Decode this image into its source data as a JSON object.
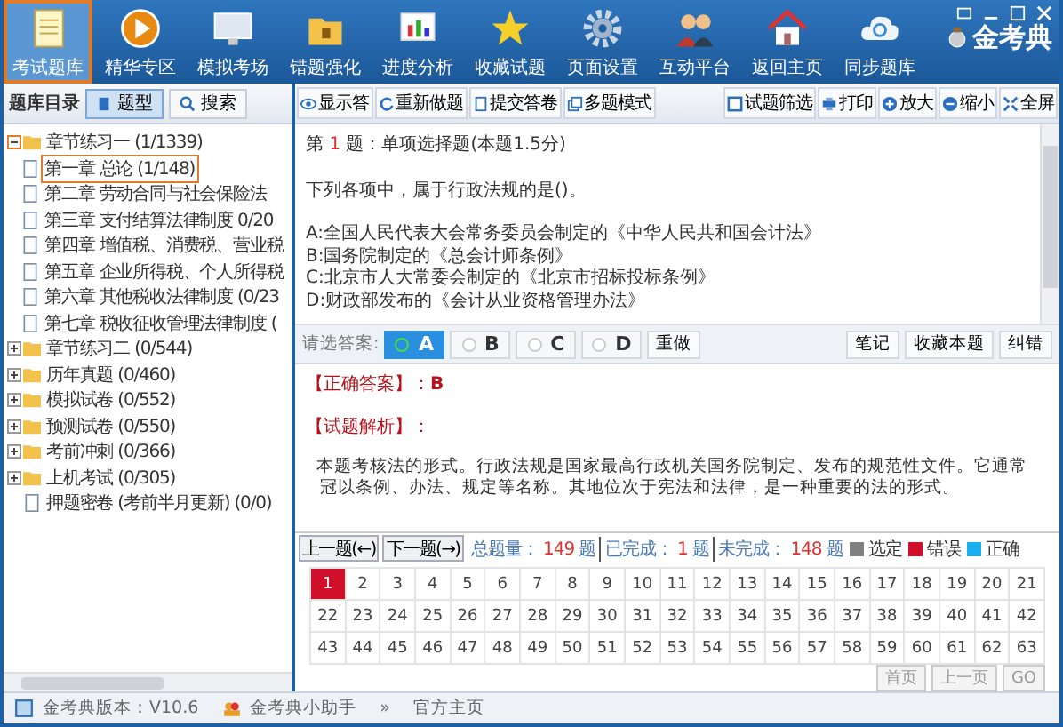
{
  "nav": [
    {
      "label": "考试题库",
      "selected": true
    },
    {
      "label": "精华专区",
      "selected": false
    },
    {
      "label": "模拟考场",
      "selected": false
    },
    {
      "label": "错题强化",
      "selected": false
    },
    {
      "label": "进度分析",
      "selected": false
    },
    {
      "label": "收藏试题",
      "selected": false
    },
    {
      "label": "页面设置",
      "selected": false
    },
    {
      "label": "互动平台",
      "selected": false
    },
    {
      "label": "返回主页",
      "selected": false
    },
    {
      "label": "同步题库",
      "selected": false
    }
  ],
  "logo": "金考典",
  "sidebar": {
    "title": "题库目录",
    "tabs": [
      {
        "label": "题型",
        "selected": true
      },
      {
        "label": "搜索",
        "selected": false
      }
    ],
    "tree": [
      {
        "label": "章节练习一 (1/1339)",
        "kind": "folder",
        "expanded": true,
        "selected": false,
        "children": [
          {
            "label": "第一章 总论 (1/148)",
            "kind": "file",
            "selected": true
          },
          {
            "label": "第二章 劳动合同与社会保险法",
            "kind": "file",
            "selected": false
          },
          {
            "label": "第三章 支付结算法律制度 0/20",
            "kind": "file",
            "selected": false
          },
          {
            "label": "第四章 增值税、消费税、营业税",
            "kind": "file",
            "selected": false
          },
          {
            "label": "第五章 企业所得税、个人所得税",
            "kind": "file",
            "selected": false
          },
          {
            "label": "第六章 其他税收法律制度 (0/23",
            "kind": "file",
            "selected": false
          },
          {
            "label": "第七章 税收征收管理法律制度 (",
            "kind": "file",
            "selected": false
          }
        ]
      },
      {
        "label": "章节练习二 (0/544)",
        "kind": "folder",
        "expanded": false,
        "selected": false
      },
      {
        "label": "历年真题 (0/460)",
        "kind": "folder",
        "expanded": false,
        "selected": false
      },
      {
        "label": "模拟试卷 (0/552)",
        "kind": "folder",
        "expanded": false,
        "selected": false
      },
      {
        "label": "预测试卷 (0/550)",
        "kind": "folder",
        "expanded": false,
        "selected": false
      },
      {
        "label": "考前冲刺 (0/366)",
        "kind": "folder",
        "expanded": false,
        "selected": false
      },
      {
        "label": "上机考试 (0/305)",
        "kind": "folder",
        "expanded": false,
        "selected": false
      },
      {
        "label": "押题密卷 (考前半月更新) (0/0)",
        "kind": "file",
        "selected": false
      }
    ]
  },
  "toolbar": {
    "left": [
      "显示答",
      "重新做题",
      "提交答卷",
      "多题模式"
    ],
    "right": [
      "试题筛选",
      "打印",
      "放大",
      "缩小",
      "全屏"
    ]
  },
  "question": {
    "prefix": "第",
    "number": "1",
    "suffix": "题：单项选择题(本题1.5分)",
    "stem": "下列各项中，属于行政法规的是()。",
    "options": [
      "A:全国人民代表大会常务委员会制定的《中华人民共和国会计法》",
      "B:国务院制定的《总会计师条例》",
      "C:北京市人大常委会制定的《北京市招标投标条例》",
      "D:财政部发布的《会计从业资格管理办法》"
    ]
  },
  "answer_bar": {
    "prompt": "请选答案:",
    "choices": [
      {
        "label": "A",
        "selected": true
      },
      {
        "label": "B",
        "selected": false
      },
      {
        "label": "C",
        "selected": false
      },
      {
        "label": "D",
        "selected": false
      }
    ],
    "redo": "重做",
    "actions": [
      "笔记",
      "收藏本题",
      "纠错"
    ]
  },
  "explanation": {
    "answer_label": "【正确答案】：",
    "answer": "B",
    "analysis_label": "【试题解析】：",
    "text": "本题考核法的形式。行政法规是国家最高行政机关国务院制定、发布的规范性文件。它通常冠以条例、办法、规定等名称。其地位次于宪法和法律，是一种重要的法的形式。"
  },
  "progress": {
    "prev": "上一题(←)",
    "next": "下一题(→)",
    "stats": [
      {
        "label": "总题量：",
        "value": "149",
        "unit": "题"
      },
      {
        "label": "已完成：",
        "value": "1",
        "unit": "题"
      },
      {
        "label": "未完成：",
        "value": "148",
        "unit": "题"
      }
    ],
    "legend": [
      {
        "label": "选定",
        "color": "#808080"
      },
      {
        "label": "错误",
        "color": "#d0102a"
      },
      {
        "label": "正确",
        "color": "#1ab0ef"
      }
    ]
  },
  "grid": {
    "cells": [
      {
        "n": "1",
        "wrong": true
      },
      {
        "n": "2",
        "wrong": false
      },
      {
        "n": "3",
        "wrong": false
      },
      {
        "n": "4",
        "wrong": false
      },
      {
        "n": "5",
        "wrong": false
      },
      {
        "n": "6",
        "wrong": false
      },
      {
        "n": "7",
        "wrong": false
      },
      {
        "n": "8",
        "wrong": false
      },
      {
        "n": "9",
        "wrong": false
      },
      {
        "n": "10",
        "wrong": false
      },
      {
        "n": "11",
        "wrong": false
      },
      {
        "n": "12",
        "wrong": false
      },
      {
        "n": "13",
        "wrong": false
      },
      {
        "n": "14",
        "wrong": false
      },
      {
        "n": "15",
        "wrong": false
      },
      {
        "n": "16",
        "wrong": false
      },
      {
        "n": "17",
        "wrong": false
      },
      {
        "n": "18",
        "wrong": false
      },
      {
        "n": "19",
        "wrong": false
      },
      {
        "n": "20",
        "wrong": false
      },
      {
        "n": "21",
        "wrong": false
      },
      {
        "n": "22",
        "wrong": false
      },
      {
        "n": "23",
        "wrong": false
      },
      {
        "n": "24",
        "wrong": false
      },
      {
        "n": "25",
        "wrong": false
      },
      {
        "n": "26",
        "wrong": false
      },
      {
        "n": "27",
        "wrong": false
      },
      {
        "n": "28",
        "wrong": false
      },
      {
        "n": "29",
        "wrong": false
      },
      {
        "n": "30",
        "wrong": false
      },
      {
        "n": "31",
        "wrong": false
      },
      {
        "n": "32",
        "wrong": false
      },
      {
        "n": "33",
        "wrong": false
      },
      {
        "n": "34",
        "wrong": false
      },
      {
        "n": "35",
        "wrong": false
      },
      {
        "n": "36",
        "wrong": false
      },
      {
        "n": "37",
        "wrong": false
      },
      {
        "n": "38",
        "wrong": false
      },
      {
        "n": "39",
        "wrong": false
      },
      {
        "n": "40",
        "wrong": false
      },
      {
        "n": "41",
        "wrong": false
      },
      {
        "n": "42",
        "wrong": false
      },
      {
        "n": "43",
        "wrong": false
      },
      {
        "n": "44",
        "wrong": false
      },
      {
        "n": "45",
        "wrong": false
      },
      {
        "n": "46",
        "wrong": false
      },
      {
        "n": "47",
        "wrong": false
      },
      {
        "n": "48",
        "wrong": false
      },
      {
        "n": "49",
        "wrong": false
      },
      {
        "n": "50",
        "wrong": false
      },
      {
        "n": "51",
        "wrong": false
      },
      {
        "n": "52",
        "wrong": false
      },
      {
        "n": "53",
        "wrong": false
      },
      {
        "n": "54",
        "wrong": false
      },
      {
        "n": "55",
        "wrong": false
      },
      {
        "n": "56",
        "wrong": false
      },
      {
        "n": "57",
        "wrong": false
      },
      {
        "n": "58",
        "wrong": false
      },
      {
        "n": "59",
        "wrong": false
      },
      {
        "n": "60",
        "wrong": false
      },
      {
        "n": "61",
        "wrong": false
      },
      {
        "n": "62",
        "wrong": false
      },
      {
        "n": "63",
        "wrong": false
      }
    ],
    "pager": [
      "首页",
      "上一页",
      "GO"
    ]
  },
  "status_bar": {
    "version": "金考典版本：V10.6",
    "helper": "金考典小助手",
    "separator": "»",
    "homepage": "官方主页"
  }
}
